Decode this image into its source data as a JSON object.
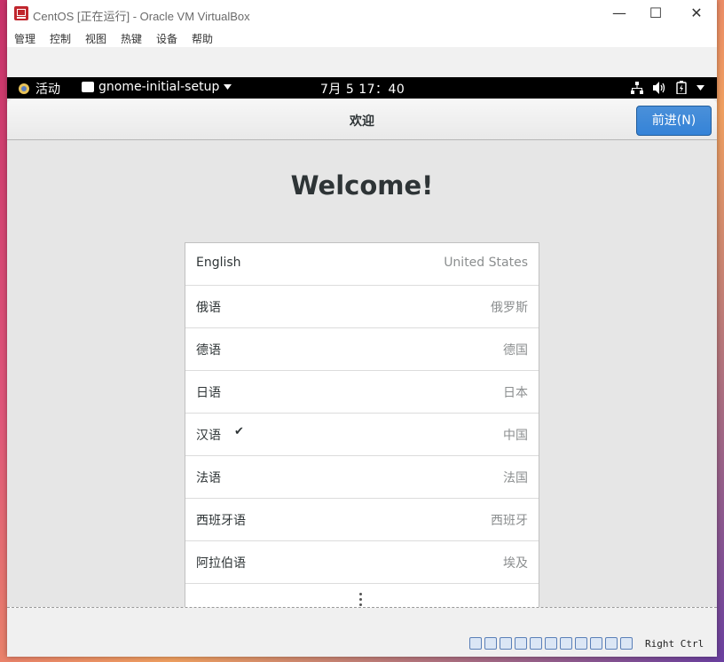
{
  "window": {
    "title": "CentOS [正在运行] - Oracle VM VirtualBox",
    "minimize": "—",
    "maximize": "☐",
    "close": "✕"
  },
  "menubar": {
    "items": [
      "管理",
      "控制",
      "视图",
      "热键",
      "设备",
      "帮助"
    ]
  },
  "topbar": {
    "activities": "活动",
    "app_name": "gnome-initial-setup",
    "clock": "7月 5  17：40"
  },
  "headerbar": {
    "title": "欢迎",
    "next_label": "前进(N)"
  },
  "welcome": {
    "heading": "Welcome!"
  },
  "languages": [
    {
      "name": "English",
      "region": "United States",
      "selected": false
    },
    {
      "name": "俄语",
      "region": "俄罗斯",
      "selected": false
    },
    {
      "name": "德语",
      "region": "德国",
      "selected": false
    },
    {
      "name": "日语",
      "region": "日本",
      "selected": false
    },
    {
      "name": "汉语",
      "region": "中国",
      "selected": true
    },
    {
      "name": "法语",
      "region": "法国",
      "selected": false
    },
    {
      "name": "西班牙语",
      "region": "西班牙",
      "selected": false
    },
    {
      "name": "阿拉伯语",
      "region": "埃及",
      "selected": false
    }
  ],
  "statusbar": {
    "host_key": "Right Ctrl"
  }
}
